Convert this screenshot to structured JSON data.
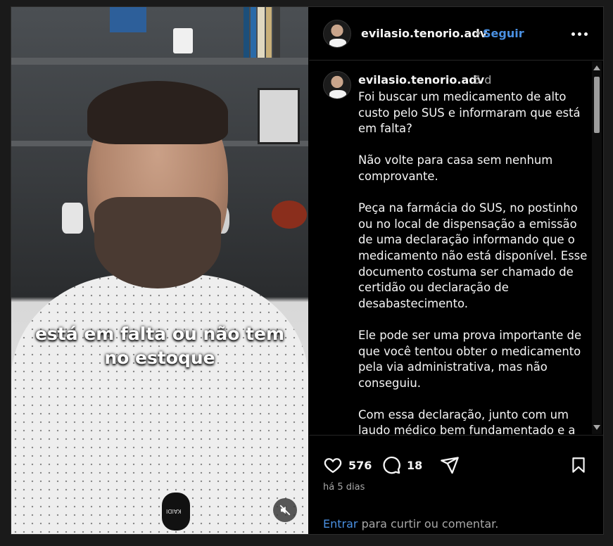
{
  "post": {
    "username": "evilasio.tenorio.adv",
    "separator": "•",
    "follow_label": "Seguir",
    "more_icon": "more-horizontal-icon"
  },
  "video": {
    "caption_line1": "está em falta ou não tem",
    "caption_line2": "no estoque",
    "mic_label": "KAIDI",
    "mute_icon": "volume-muted-icon"
  },
  "comment": {
    "username": "evilasio.tenorio.adv",
    "age": "5 d",
    "text": "Foi buscar um medicamento de alto\ncusto pelo SUS e informaram que está\nem falta?\n\nNão volte para casa sem nenhum\ncomprovante.\n\nPeça na farmácia do SUS, no postinho\nou no local de dispensação a emissão\nde uma declaração informando que o\nmedicamento não está disponível. Esse\ndocumento costuma ser chamado de\ncertidão ou declaração de\ndesabastecimento.\n\nEle pode ser uma prova importante de\nque você tentou obter o medicamento\npela via administrativa, mas não\nconseguiu.\n\nCom essa declaração, junto com um\nlaudo médico bem fundamentado e a"
  },
  "actions": {
    "likes": "576",
    "comments": "18",
    "posted": "há 5 dias",
    "login_link": "Entrar",
    "login_text": " para curtir ou comentar."
  },
  "colors": {
    "accent": "#4a90e2",
    "background": "#000000",
    "muted_text": "#a8a8a8"
  }
}
